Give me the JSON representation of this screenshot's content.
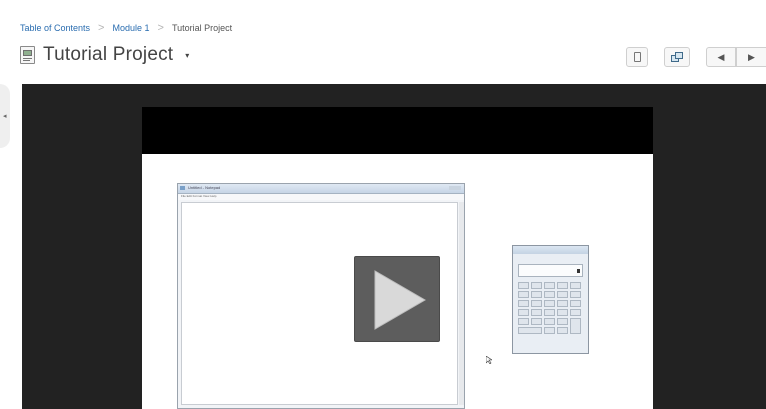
{
  "breadcrumb": {
    "items": [
      "Table of Contents",
      "Module 1",
      "Tutorial Project"
    ],
    "separator": ">"
  },
  "header": {
    "title": "Tutorial Project",
    "icon": "document-icon",
    "dropdown_icon": "caret-down-icon"
  },
  "toolbar": {
    "buttons": [
      {
        "name": "bookmark-button",
        "icon": "bookmark-icon"
      },
      {
        "name": "copy-button",
        "icon": "copy-icon"
      },
      {
        "name": "previous-button",
        "icon": "triangle-left-icon",
        "glyph": "◀"
      },
      {
        "name": "next-button",
        "icon": "triangle-right-icon",
        "glyph": "▶"
      }
    ]
  },
  "viewer": {
    "background": "#222222",
    "video_thumbnail": {
      "description_icons": [
        "notepad-window-icon",
        "calculator-icon",
        "play-icon",
        "cursor-icon"
      ],
      "notepad_title": "Untitled - Notepad",
      "notepad_menu": "File  Edit  Format  View  Help"
    }
  },
  "colors": {
    "link": "#2a6db0",
    "title": "#444444",
    "play_button": "#5d5d5d"
  }
}
